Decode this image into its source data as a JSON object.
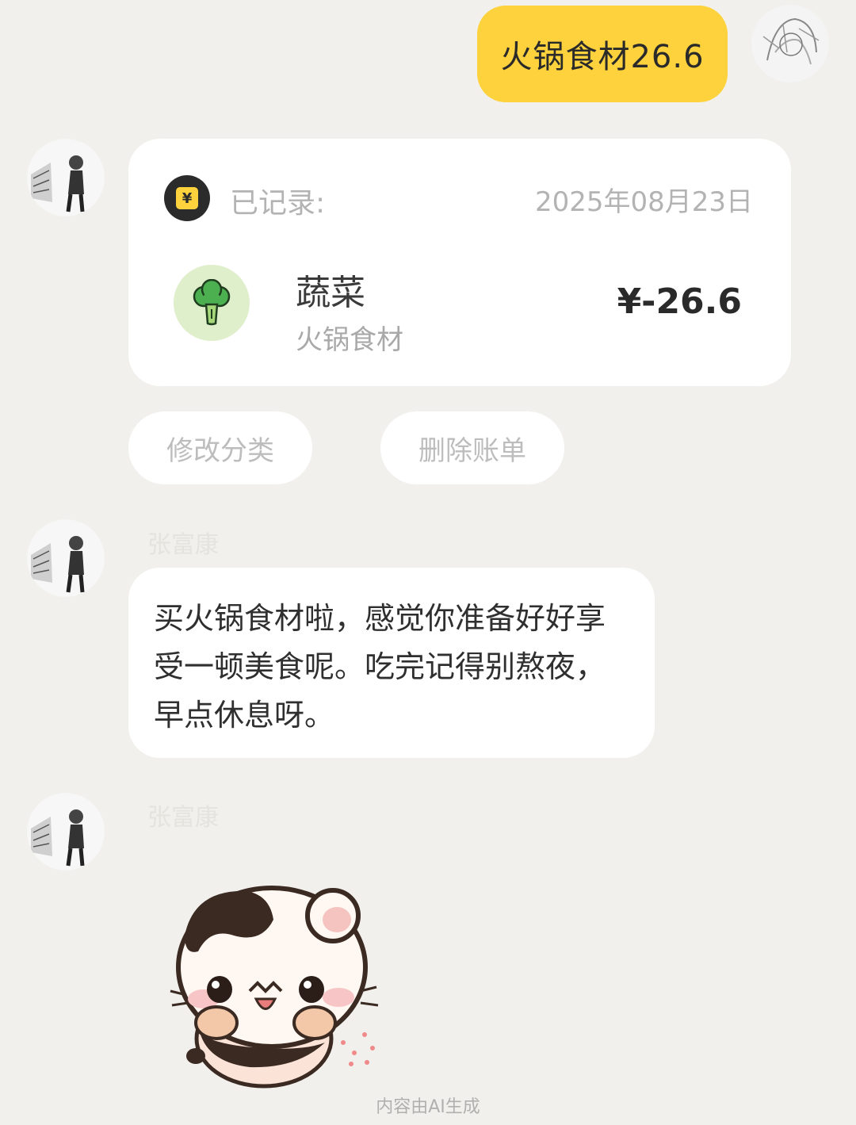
{
  "user_message": {
    "text": "火锅食材26.6"
  },
  "record_card": {
    "label": "已记录:",
    "date": "2025年08月23日",
    "badge_symbol": "¥",
    "category": {
      "name": "蔬菜",
      "note": "火锅食材",
      "icon": "broccoli-icon"
    },
    "amount": "¥-26.6"
  },
  "actions": {
    "edit_category": "修改分类",
    "delete_bill": "删除账单"
  },
  "bot": {
    "name": "张富康"
  },
  "reply": {
    "text": "买火锅食材啦，感觉你准备好好享受一顿美食呢。吃完记得别熬夜，早点休息呀。"
  },
  "sticker": {
    "icon": "hamster-sticker"
  },
  "footer": {
    "text": "内容由AI生成"
  },
  "colors": {
    "accent": "#fdd23c",
    "background": "#f1f0ec",
    "card": "#ffffff",
    "category_bg": "#dfeecb"
  }
}
